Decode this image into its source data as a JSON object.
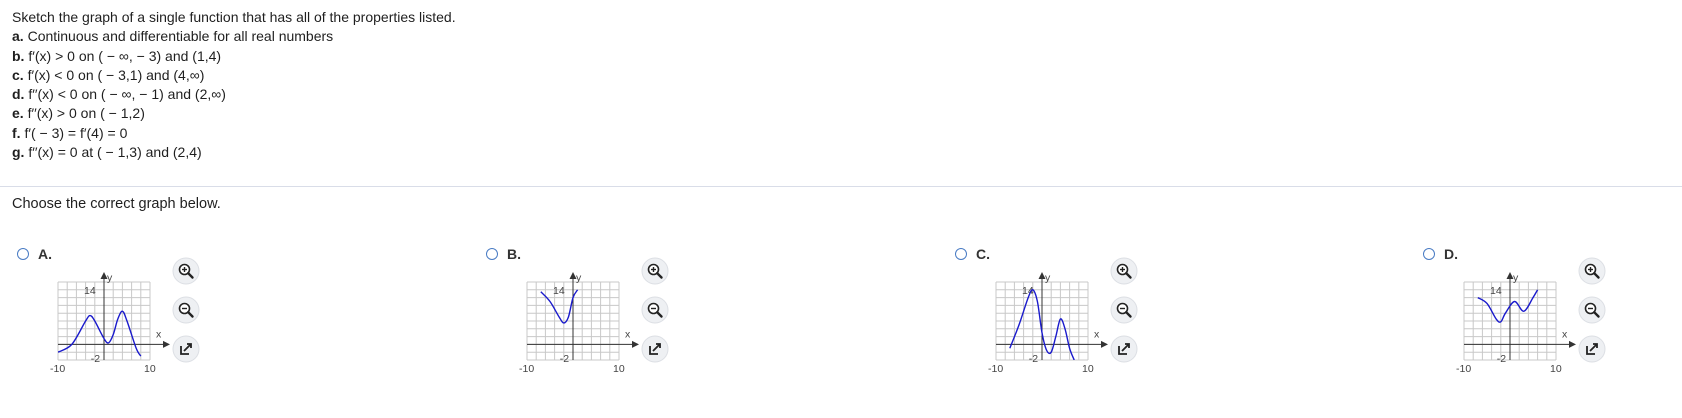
{
  "question": {
    "intro": "Sketch the graph of a single function that has all of the properties listed.",
    "properties": [
      {
        "letter": "a.",
        "text": " Continuous and differentiable for all real numbers"
      },
      {
        "letter": "b.",
        "text": " f′(x) > 0 on ( − ∞, − 3) and (1,4)"
      },
      {
        "letter": "c.",
        "text": " f′(x) < 0 on ( − 3,1) and (4,∞)"
      },
      {
        "letter": "d.",
        "text": " f′′(x) < 0 on ( − ∞, − 1) and (2,∞)"
      },
      {
        "letter": "e.",
        "text": " f′′(x) > 0 on ( − 1,2)"
      },
      {
        "letter": "f.",
        "text": " f′( − 3) = f′(4) = 0"
      },
      {
        "letter": "g.",
        "text": " f′′(x) = 0 at ( − 1,3) and (2,4)"
      }
    ]
  },
  "prompt": "Choose the correct graph below.",
  "axis_labels": {
    "y": "y",
    "x": "x",
    "y_tick": "14",
    "x_min": "-10",
    "x_mid": "-2",
    "x_max": "10"
  },
  "colors": {
    "curve": "#1a1acc",
    "grid": "#c8c8c8",
    "radio": "#4a7cc4"
  },
  "tool_icons": [
    "zoom-in-icon",
    "zoom-out-icon",
    "popout-icon"
  ],
  "options": [
    {
      "label": "A.",
      "shape": "up",
      "points": [
        [
          -10,
          -2
        ],
        [
          -7,
          0
        ],
        [
          -4,
          6
        ],
        [
          -3,
          7.4
        ],
        [
          -2,
          6
        ],
        [
          0,
          1.5
        ],
        [
          1,
          0.4
        ],
        [
          2,
          2.5
        ],
        [
          3,
          6.5
        ],
        [
          4,
          8.5
        ],
        [
          5,
          6
        ],
        [
          7,
          -1
        ],
        [
          8,
          -3
        ]
      ]
    },
    {
      "label": "B.",
      "shape": "down",
      "points": [
        [
          -7,
          13.5
        ],
        [
          -5,
          11
        ],
        [
          -3,
          7
        ],
        [
          -2,
          5.5
        ],
        [
          -1,
          7
        ],
        [
          0,
          12
        ],
        [
          1,
          14
        ]
      ]
    },
    {
      "label": "C.",
      "shape": "up",
      "points": [
        [
          -7,
          -1
        ],
        [
          -5,
          5
        ],
        [
          -3,
          12
        ],
        [
          -2,
          14
        ],
        [
          -1,
          11
        ],
        [
          0,
          3
        ],
        [
          1,
          -1.5
        ],
        [
          2,
          -2
        ],
        [
          3,
          2
        ],
        [
          4,
          6.5
        ],
        [
          5,
          4
        ],
        [
          6,
          -1
        ],
        [
          7,
          -4
        ]
      ]
    },
    {
      "label": "D.",
      "shape": "down",
      "points": [
        [
          -7,
          12
        ],
        [
          -5,
          10.5
        ],
        [
          -3,
          6.5
        ],
        [
          -2,
          5.8
        ],
        [
          -1,
          8
        ],
        [
          1,
          11
        ],
        [
          3,
          8.5
        ],
        [
          5,
          12
        ],
        [
          6,
          14
        ]
      ]
    }
  ]
}
